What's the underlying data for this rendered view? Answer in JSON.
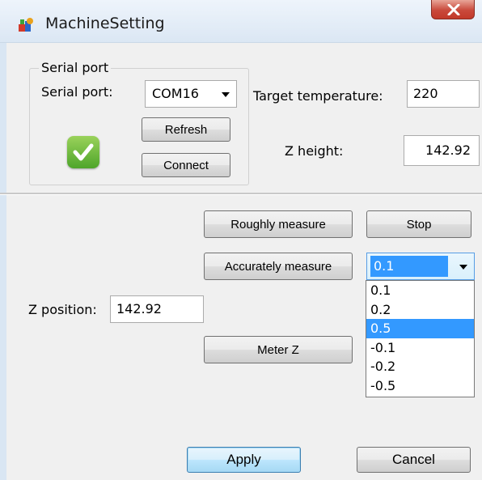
{
  "window": {
    "title": "MachineSetting"
  },
  "serial": {
    "group_title": "Serial port",
    "port_label": "Serial port:",
    "port_value": "COM16",
    "refresh_label": "Refresh",
    "connect_label": "Connect",
    "status_icon": "check-icon",
    "status_color": "#5cb82f"
  },
  "params": {
    "target_temp_label": "Target temperature:",
    "target_temp_value": "220",
    "z_height_label": "Z height:",
    "z_height_value": "142.92"
  },
  "measure": {
    "roughly_label": "Roughly measure",
    "stop_label": "Stop",
    "accurately_label": "Accurately measure",
    "step_value": "0.1",
    "step_options": [
      "0.1",
      "0.2",
      "0.5",
      "-0.1",
      "-0.2",
      "-0.5"
    ],
    "step_highlighted": "0.5",
    "z_position_label": "Z position:",
    "z_position_value": "142.92",
    "meter_z_label": "Meter Z"
  },
  "footer": {
    "apply_label": "Apply",
    "cancel_label": "Cancel"
  }
}
